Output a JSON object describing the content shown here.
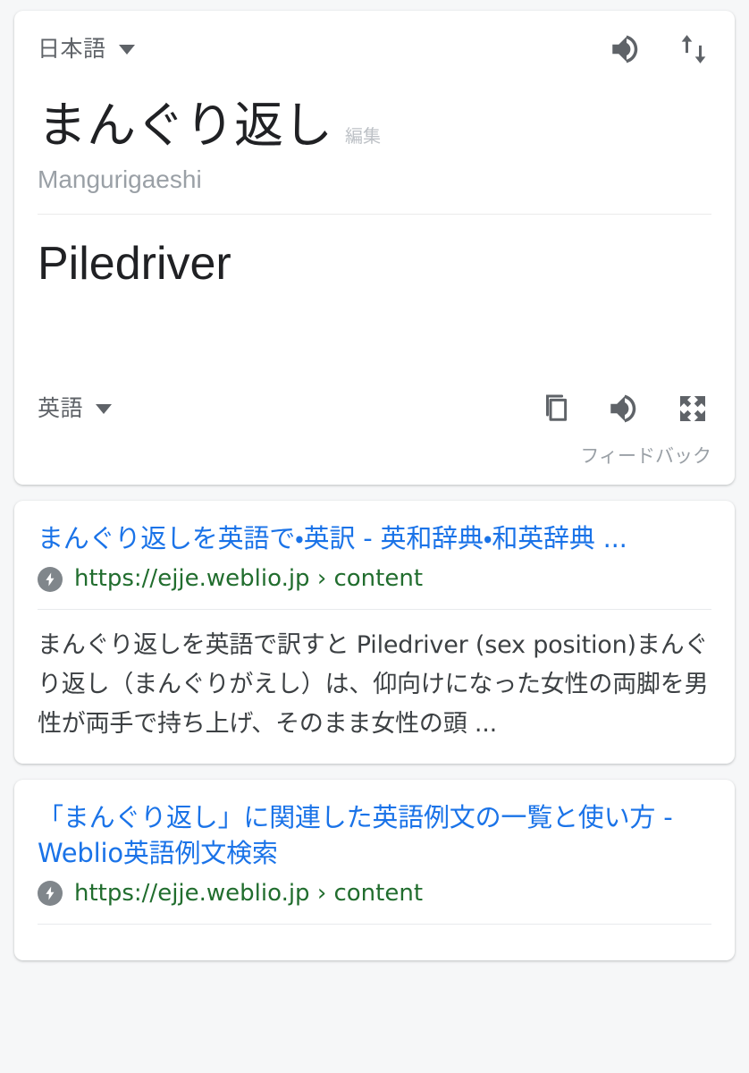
{
  "translate_card": {
    "source_language": {
      "label": "日本語",
      "chevron_icon": "chevron-down-icon"
    },
    "target_language": {
      "label": "英語",
      "chevron_icon": "chevron-down-icon"
    },
    "header_icons": [
      {
        "name": "speaker-icon",
        "title": "音声を聞く"
      },
      {
        "name": "swap-languages-icon",
        "title": "言語を入れ替え"
      }
    ],
    "source_text": "まんぐり返し",
    "edit_label": "編集",
    "romanization": "Mangurigaeshi",
    "translated_text": "Piledriver",
    "result_icons": [
      {
        "name": "copy-icon",
        "title": "コピー"
      },
      {
        "name": "speaker-icon",
        "title": "音声を聞く"
      },
      {
        "name": "fullscreen-icon",
        "title": "全画面表示"
      }
    ],
    "feedback_label": "フィードバック"
  },
  "results": [
    {
      "title": "まんぐり返しを英語で・英訳 - 英和辞典・和英辞典 ...",
      "url": "https://ejje.weblio.jp › content",
      "amp_icon": "amp-lightning-icon",
      "snippet": "まんぐり返しを英語で訳すと Piledriver (sex position)まんぐり返し（まんぐりがえし）は、仰向けになった女性の両脚を男性が両手で持ち上げ、そのまま女性の頭 ..."
    },
    {
      "title": "「まんぐり返し」に関連した英語例文の一覧と使い方 - Weblio英語例文検索",
      "url": "https://ejje.weblio.jp › content",
      "amp_icon": "amp-lightning-icon",
      "snippet": ""
    }
  ],
  "colors": {
    "page_background": "#f6f7f8",
    "card_background": "#ffffff",
    "link_blue": "#1a73e8",
    "url_green": "#216d2e",
    "primary_text": "#202124",
    "secondary_text": "#5f6368",
    "muted_text": "#9aa0a6",
    "divider": "#e8eaed"
  }
}
